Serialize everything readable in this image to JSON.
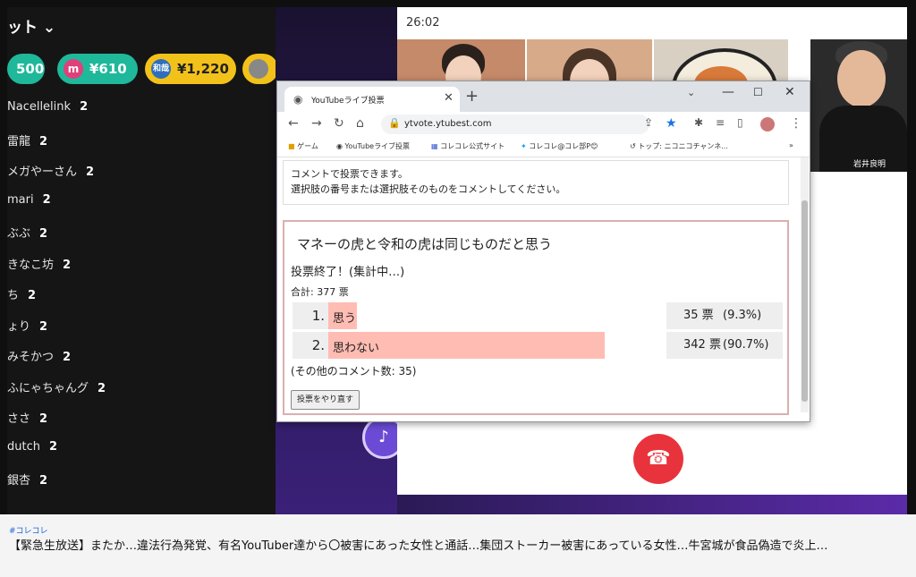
{
  "chat": {
    "title": "ット ⌄",
    "superchats": [
      {
        "amount": "500"
      },
      {
        "avatar_letter": "m",
        "amount": "¥610"
      },
      {
        "avatar_letter": "和哉",
        "amount": "¥1,220"
      }
    ],
    "messages": [
      {
        "name": "Nacellelink",
        "count": "2"
      },
      {
        "name": "雷龍",
        "count": "2"
      },
      {
        "name": "メガやーさん",
        "count": "2"
      },
      {
        "name": "mari",
        "count": "2"
      },
      {
        "name": "ぶぶ",
        "count": "2"
      },
      {
        "name": "きなこ坊",
        "count": "2"
      },
      {
        "name": "ち",
        "count": "2"
      },
      {
        "name": "ょり",
        "count": "2"
      },
      {
        "name": "みそかつ",
        "count": "2"
      },
      {
        "name": "ふにゃちゃんグ",
        "count": "2"
      },
      {
        "name": "ささ",
        "count": "2"
      },
      {
        "name": "dutch",
        "count": "2"
      },
      {
        "name": "銀杏",
        "count": "2"
      }
    ]
  },
  "call": {
    "timer": "26:02",
    "participant_name": "岩井良明"
  },
  "browser": {
    "tab_title": "YouTubeライブ投票",
    "url": "ytvote.ytubest.com",
    "bookmarks": [
      "ゲーム",
      "YouTubeライブ投票",
      "コレコレ公式サイト",
      "コレコレ@コレ部P😊",
      "トップ: ニコニコチャンネ..."
    ]
  },
  "poll": {
    "instructions_line1": "コメントで投票できます。",
    "instructions_line2": "選択肢の番号または選択肢そのものをコメントしてください。",
    "question": "マネーの虎と令和の虎は同じものだと思う",
    "status": "投票終了！(集計中…)",
    "total": "合計: 377 票",
    "options": [
      {
        "number": "1.",
        "label": "思う",
        "votes": "35 票",
        "percent": "(9.3%)",
        "fraction": 0.093
      },
      {
        "number": "2.",
        "label": "思わない",
        "votes": "342 票",
        "percent": "(90.7%)",
        "fraction": 0.907
      }
    ],
    "other_comments": "(その他のコメント数: 35)",
    "retry_label": "投票をやり直す"
  },
  "caption": {
    "hashtag": "#コレコレ",
    "title": "【緊急生放送】またか…違法行為発覚、有名YouTuber達から〇被害にあった女性と通話…集団ストーカー被害にあっている女性…牛宮城が食品偽造で炎上…"
  },
  "colors": {
    "bar": "#ffbcb3",
    "hangup": "#e8333d",
    "hashtag": "#1a63d6"
  }
}
